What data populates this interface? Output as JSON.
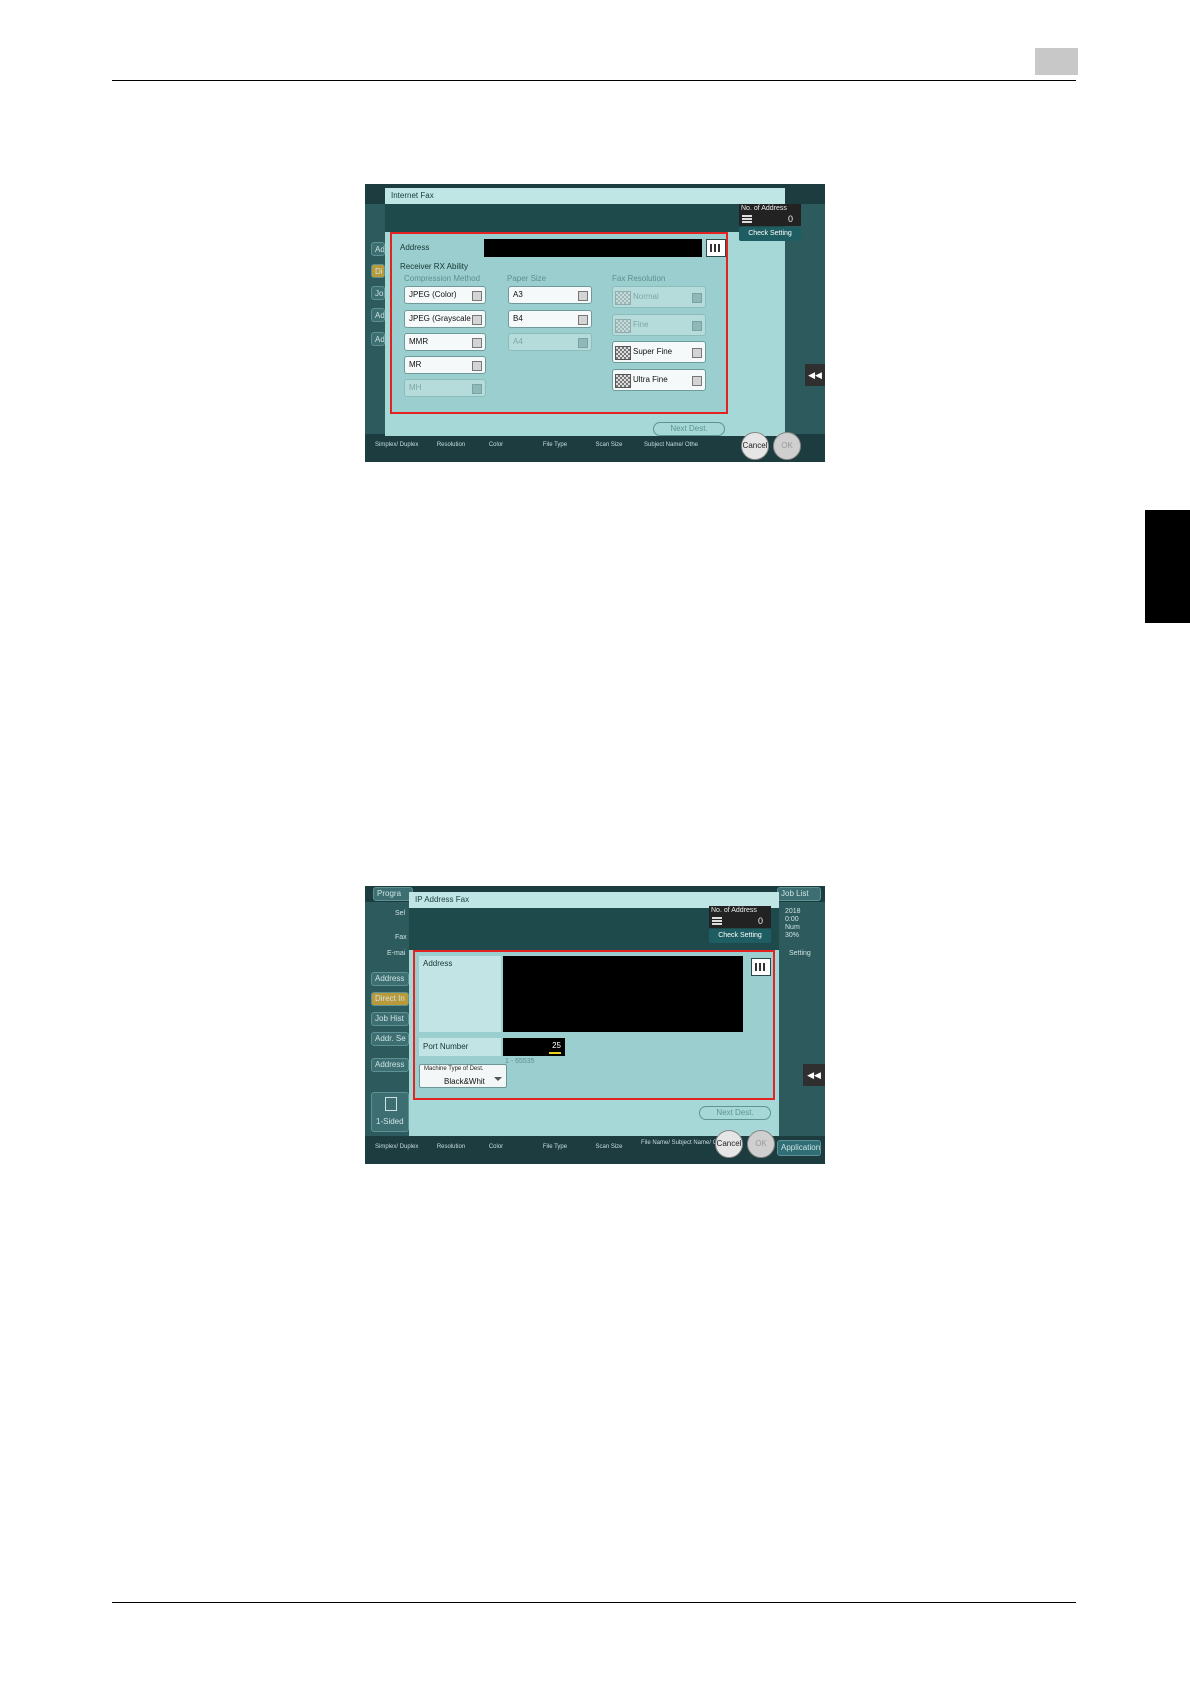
{
  "shot1": {
    "dialog_title": "Internet Fax",
    "address_label": "Address",
    "no_of_address_label": "No. of Address",
    "no_of_address_value": "0",
    "check_setting": "Check Setting",
    "receiver_rx_ability": "Receiver RX Ability",
    "compression_method_label": "Compression Method",
    "paper_size_label": "Paper Size",
    "fax_resolution_label": "Fax Resolution",
    "compression_options": [
      "JPEG (Color)",
      "JPEG (Grayscale",
      "MMR",
      "MR",
      "MH"
    ],
    "paper_options": [
      "A3",
      "B4",
      "A4"
    ],
    "resolution_options": [
      "Normal",
      "Fine",
      "Super Fine",
      "Ultra Fine"
    ],
    "next_dest": "Next Dest.",
    "cancel": "Cancel",
    "ok": "OK",
    "bg_left": [
      "Ad",
      "Di",
      "Jo",
      "Ad",
      "Ad"
    ],
    "bottom_labels": [
      "Simplex/ Duplex",
      "Resolution",
      "Color",
      "File Type",
      "Scan Size",
      "Subject Name/ Othe"
    ]
  },
  "shot2": {
    "dialog_title": "IP Address Fax",
    "address_label": "Address",
    "no_of_address_label": "No. of Address",
    "no_of_address_value": "0",
    "check_setting": "Check Setting",
    "port_number_label": "Port Number",
    "port_number_value": "25",
    "port_range": "1 - 65535",
    "machine_type_label": "Machine Type of Dest.",
    "machine_type_value": "Black&Whit",
    "next_dest": "Next Dest.",
    "cancel": "Cancel",
    "ok": "OK",
    "top_bar": [
      "Progra",
      "Job List"
    ],
    "bg_left": [
      "Sel",
      "Fax",
      "E-mai",
      "Address",
      "Direct In",
      "Job Hist",
      "Addr. Se",
      "Address"
    ],
    "bg_right": [
      "Setting",
      "2018",
      "0:00",
      "Num",
      "30%"
    ],
    "side_doc": "1-Sided",
    "bottom_labels": [
      "Simplex/ Duplex",
      "Resolution",
      "Color",
      "File Type",
      "Scan Size",
      "File Name/ Subject Name/ Othe"
    ],
    "application": "Application"
  }
}
